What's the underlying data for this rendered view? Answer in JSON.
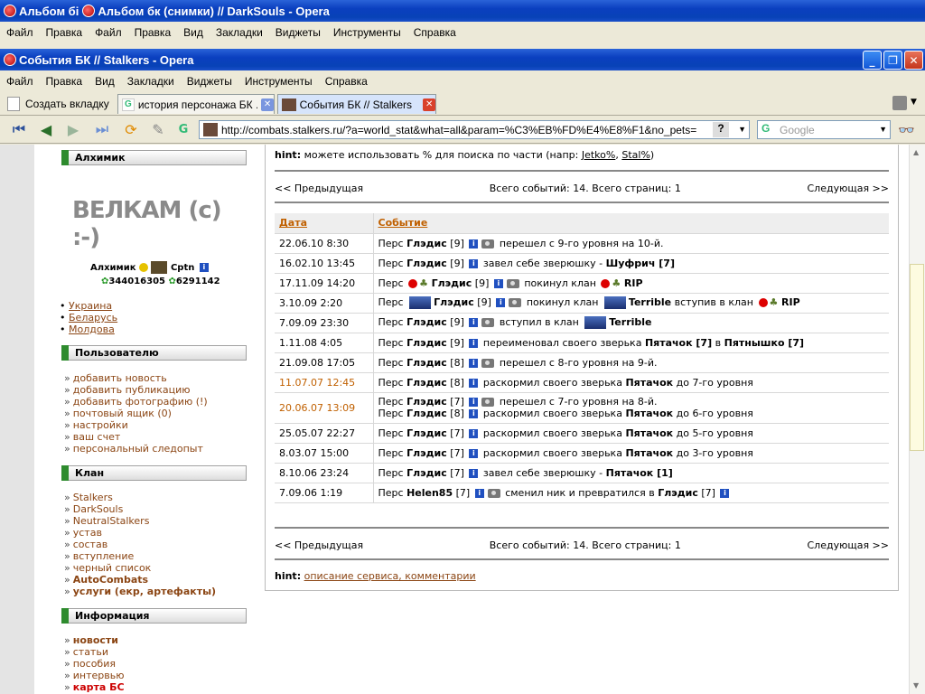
{
  "window_back": {
    "title_part1": "Альбом бі",
    "title_part2": "Альбом бк (снимки) // DarkSouls - Opera"
  },
  "menubar_back": [
    "Файл",
    "Правка",
    "Файл",
    "Правка",
    "Вид",
    "Закладки",
    "Виджеты",
    "Инструменты",
    "Справка"
  ],
  "window": {
    "title": "События БК // Stalkers - Opera"
  },
  "menubar": [
    "Файл",
    "Правка",
    "Вид",
    "Закладки",
    "Виджеты",
    "Инструменты",
    "Справка"
  ],
  "tabs": {
    "new_tab": "Создать вкладку",
    "tab1": "история персонажа БК ...",
    "tab2": "События БК // Stalkers"
  },
  "address": {
    "url": "http://combats.stalkers.ru/?a=world_stat&what=all&param=%C3%EB%FD%E4%E8%F1&no_pets="
  },
  "search": {
    "placeholder": "Google"
  },
  "sidebar": {
    "alchemist_head": "Алхимик",
    "welcome": "ВЕЛКАМ (с) :-)",
    "alchemist_line": "Алхимик",
    "cptn": "Cptn",
    "icq1": "344016305",
    "icq2": "6291142",
    "countries": [
      "Украина",
      "Беларусь",
      "Молдова"
    ],
    "user_head": "Пользователю",
    "user_links": [
      "добавить новость",
      "добавить публикацию",
      "добавить фотографию (!)",
      "почтовый ящик (0)",
      "настройки",
      "ваш счет",
      "персональный следопыт"
    ],
    "clan_head": "Клан",
    "clan_links": [
      "Stalkers",
      "DarkSouls",
      "NeutralStalkers",
      "устав",
      "состав",
      "вступление",
      "черный список",
      "AutoCombats",
      "услуги (екр, артефакты)"
    ],
    "info_head": "Информация",
    "info_links": [
      "новости",
      "статьи",
      "пособия",
      "интервью",
      "карта БС"
    ]
  },
  "content": {
    "hint_label": "hint:",
    "hint_text": "можете использовать % для поиска по части (напр:",
    "hint_ex1": "Jetko%",
    "hint_ex2": "Stal%",
    "hint_close": ")",
    "prev": "<< Предыдущая",
    "summary": "Всего событий: 14. Всего страниц: 1",
    "next": "Следующая >>",
    "col_date": "Дата",
    "col_event": "Событие",
    "footer_hint_label": "hint:",
    "footer_hint_link": "описание сервиса, комментарии"
  },
  "events": [
    {
      "date": "22.06.10 8:30",
      "text": "Перс Глэдис [9] перешел с 9-го уровня на 10-й."
    },
    {
      "date": "16.02.10 13:45",
      "text": "Перс Глэдис [9] завел себе зверюшку - Шуфрич [7]"
    },
    {
      "date": "17.11.09 14:20",
      "text": "Перс Глэдис [9] покинул клан RIP"
    },
    {
      "date": "3.10.09 2:20",
      "text": "Перс Глэдис [9] покинул клан Terrible вступив в клан RIP"
    },
    {
      "date": "7.09.09 23:30",
      "text": "Перс Глэдис [9] вступил в клан Terrible"
    },
    {
      "date": "1.11.08 4:05",
      "text": "Перс Глэдис [9] переименовал своего зверька Пятачок [7] в Пятнышко [7]"
    },
    {
      "date": "21.09.08 17:05",
      "text": "Перс Глэдис [8] перешел с 8-го уровня на 9-й."
    },
    {
      "date": "11.07.07 12:45",
      "text": "Перс Глэдис [8] раскормил своего зверька Пятачок до 7-го уровня"
    },
    {
      "date": "20.06.07 13:09",
      "text": "Перс Глэдис [7] перешел с 7-го уровня на 8-й. / Перс Глэдис [8] раскормил своего зверька Пятачок до 6-го уровня"
    },
    {
      "date": "25.05.07 22:27",
      "text": "Перс Глэдис [7] раскормил своего зверька Пятачок до 5-го уровня"
    },
    {
      "date": "8.03.07 15:00",
      "text": "Перс Глэдис [7] раскормил своего зверька Пятачок до 3-го уровня"
    },
    {
      "date": "8.10.06 23:24",
      "text": "Перс Глэдис [7] завел себе зверюшку - Пятачок [1]"
    },
    {
      "date": "7.09.06 1:19",
      "text": "Перс Helen85 [7] сменил ник и превратился в Глэдис [7]"
    }
  ],
  "colors": {
    "title_blue": "#0a3fbf",
    "link_brown": "#8b4513",
    "date_orange": "#c06000",
    "section_green": "#2e8b2e"
  }
}
